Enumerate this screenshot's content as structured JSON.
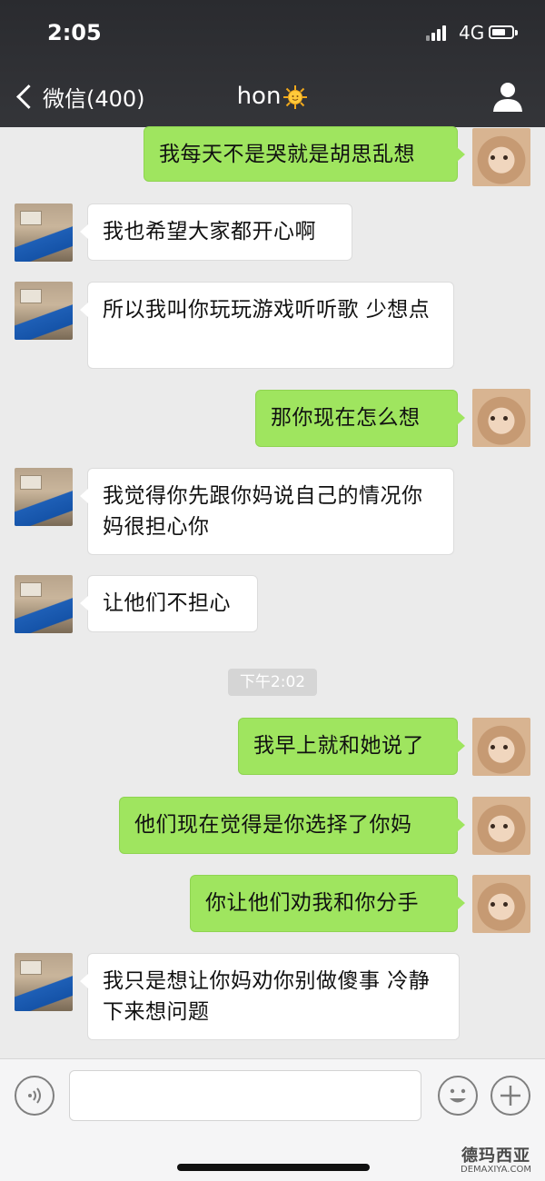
{
  "status_bar": {
    "time": "2:05",
    "network": "4G"
  },
  "nav": {
    "back_label": "微信(400)",
    "title": "hon"
  },
  "messages": [
    {
      "side": "right",
      "text": "我每天不是哭就是胡思乱想"
    },
    {
      "side": "left",
      "text": "我也希望大家都开心啊"
    },
    {
      "side": "left",
      "text": "所以我叫你玩玩游戏听听歌 少想点"
    },
    {
      "side": "right",
      "text": "那你现在怎么想"
    },
    {
      "side": "left",
      "text": "我觉得你先跟你妈说自己的情况你妈很担心你"
    },
    {
      "side": "left",
      "text": "让他们不担心"
    },
    {
      "side": "right",
      "text": "我早上就和她说了"
    },
    {
      "side": "right",
      "text": "他们现在觉得是你选择了你妈"
    },
    {
      "side": "right",
      "text": "你让他们劝我和你分手"
    },
    {
      "side": "left",
      "text": "我只是想让你妈劝你别做傻事 冷静下来想问题"
    }
  ],
  "time_separator": "下午2:02",
  "input": {
    "value": ""
  },
  "watermark": {
    "main": "德玛西亚",
    "sub": "DEMAXIYA.COM"
  },
  "colors": {
    "header_bg": "#2e2f33",
    "chat_bg": "#ebebeb",
    "sent_bubble": "#9fe55f",
    "received_bubble": "#ffffff"
  },
  "icons": [
    "chevron-left-icon",
    "sun-emoji-icon",
    "person-icon",
    "voice-icon",
    "emoji-icon",
    "plus-icon"
  ]
}
